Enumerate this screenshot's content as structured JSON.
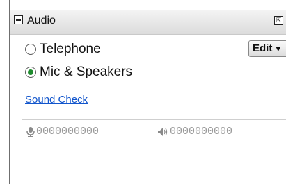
{
  "panel": {
    "title": "Audio",
    "collapse_icon": "collapse-icon",
    "popout_icon": "popout-icon"
  },
  "audio_options": [
    {
      "label": "Telephone",
      "selected": false
    },
    {
      "label": "Mic & Speakers",
      "selected": true
    }
  ],
  "edit_button": {
    "label": "Edit",
    "icon": "caret-down-icon"
  },
  "sound_check": {
    "label": "Sound Check"
  },
  "meters": {
    "mic": {
      "icon": "microphone-icon",
      "value": "0000000000"
    },
    "speaker": {
      "icon": "speaker-icon",
      "value": "0000000000"
    }
  },
  "colors": {
    "link": "#1155cc",
    "selected_radio": "#1f8b2e",
    "meter_text": "#9a9a9a"
  }
}
